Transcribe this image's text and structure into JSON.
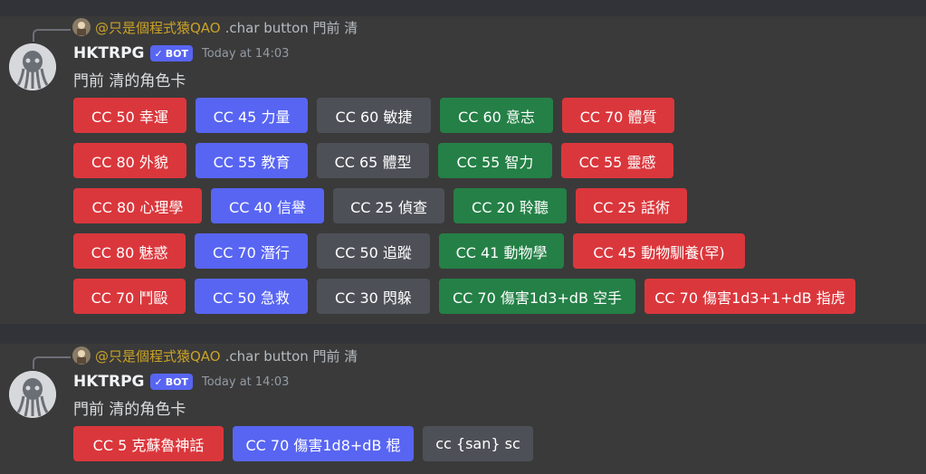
{
  "messages": [
    {
      "reply": {
        "user": "@只是個程式猿QAO",
        "text": ".char button 門前 清"
      },
      "author": "HKTRPG",
      "bot_badge": "BOT",
      "timestamp": "Today at 14:03",
      "content": "門前 清的角色卡",
      "rows": [
        [
          {
            "label": "CC 50 幸運",
            "style": "danger"
          },
          {
            "label": "CC 45 力量",
            "style": "primary"
          },
          {
            "label": "CC 60 敏捷",
            "style": "secondary"
          },
          {
            "label": "CC 60 意志",
            "style": "success"
          },
          {
            "label": "CC 70 體質",
            "style": "danger"
          }
        ],
        [
          {
            "label": "CC 80 外貌",
            "style": "danger"
          },
          {
            "label": "CC 55 教育",
            "style": "primary"
          },
          {
            "label": "CC 65 體型",
            "style": "secondary"
          },
          {
            "label": "CC 55 智力",
            "style": "success"
          },
          {
            "label": "CC 55 靈感",
            "style": "danger"
          }
        ],
        [
          {
            "label": "CC 80 心理學",
            "style": "danger"
          },
          {
            "label": "CC 40 信譽",
            "style": "primary"
          },
          {
            "label": "CC 25 偵查",
            "style": "secondary"
          },
          {
            "label": "CC 20 聆聽",
            "style": "success"
          },
          {
            "label": "CC 25 話術",
            "style": "danger"
          }
        ],
        [
          {
            "label": "CC 80 魅惑",
            "style": "danger"
          },
          {
            "label": "CC 70 潛行",
            "style": "primary"
          },
          {
            "label": "CC 50 追蹤",
            "style": "secondary"
          },
          {
            "label": "CC 41 動物學",
            "style": "success"
          },
          {
            "label": "CC 45 動物馴養(罕)",
            "style": "danger"
          }
        ],
        [
          {
            "label": "CC 70 鬥毆",
            "style": "danger"
          },
          {
            "label": "CC 50 急救",
            "style": "primary"
          },
          {
            "label": "CC 30 閃躲",
            "style": "secondary"
          },
          {
            "label": "CC 70 傷害1d3+dB 空手",
            "style": "success"
          },
          {
            "label": "CC 70 傷害1d3+1+dB 指虎",
            "style": "danger"
          }
        ]
      ]
    },
    {
      "reply": {
        "user": "@只是個程式猿QAO",
        "text": ".char button 門前 清"
      },
      "author": "HKTRPG",
      "bot_badge": "BOT",
      "timestamp": "Today at 14:03",
      "content": "門前 清的角色卡",
      "rows": [
        [
          {
            "label": "CC 5 克蘇魯神話",
            "style": "danger"
          },
          {
            "label": "CC 70 傷害1d8+dB 棍",
            "style": "primary"
          },
          {
            "label": "cc {san} sc",
            "style": "secondary"
          }
        ]
      ]
    }
  ],
  "colors": {
    "danger": "#da373c",
    "primary": "#5865f2",
    "secondary": "#4e5058",
    "success": "#248046",
    "bot_badge": "#5865f2",
    "reply_user": "#c9a227"
  }
}
